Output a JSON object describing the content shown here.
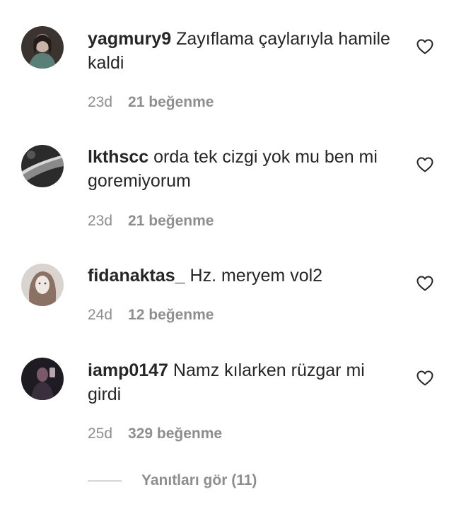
{
  "comments": [
    {
      "username": "yagmury9",
      "text": "Zayıflama çaylarıyla hamile kaldi",
      "time": "23d",
      "likes": "21 beğenme",
      "avatar_colors": [
        "#3a3330",
        "#c9b5a8",
        "#5a7f78"
      ]
    },
    {
      "username": "lkthscc",
      "text": "orda tek cizgi yok mu ben mi goremiyorum",
      "time": "23d",
      "likes": "21 beğenme",
      "avatar_colors": [
        "#2b2b2b",
        "#8a8a8a",
        "#d8d8d8"
      ]
    },
    {
      "username": "fidanaktas_",
      "text": "Hz. meryem vol2",
      "time": "24d",
      "likes": "12 beğenme",
      "avatar_colors": [
        "#d9d4d0",
        "#8b7064",
        "#efe8e2"
      ]
    },
    {
      "username": "iamp0147",
      "text": "Namz kılarken rüzgar mi girdi",
      "time": "25d",
      "likes": "329 beğenme",
      "avatar_colors": [
        "#1e1b22",
        "#7a5a68",
        "#3a2f3c"
      ]
    }
  ],
  "view_replies_label": "Yanıtları gör (11)",
  "icons": {
    "like": "heart-outline-icon"
  }
}
